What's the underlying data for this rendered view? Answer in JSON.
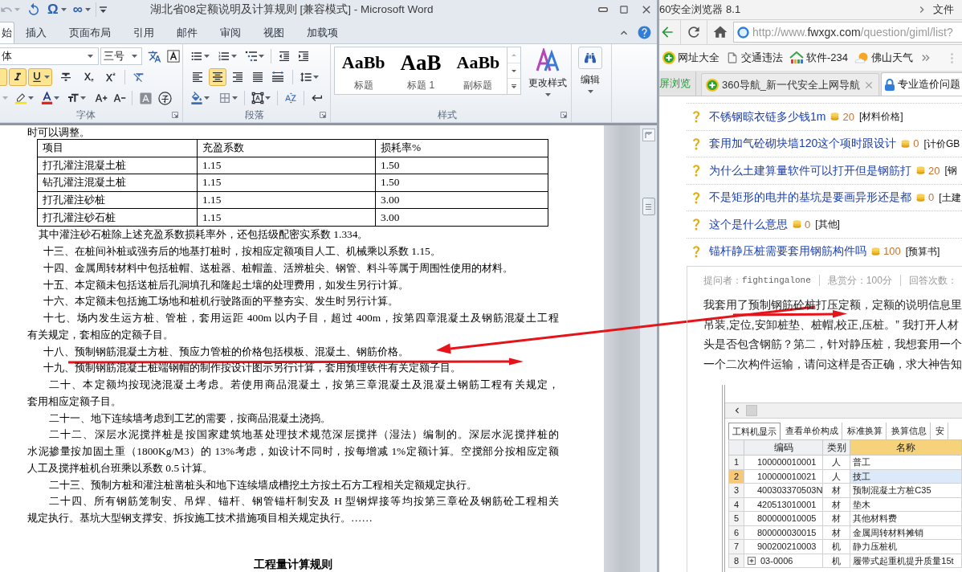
{
  "word": {
    "title": "湖北省08定额说明及计算规则 [兼容模式] - Microsoft Word",
    "quick_access_symbols": [
      "Ω",
      "∞"
    ],
    "tabs": [
      {
        "label": "始",
        "selected": true
      },
      {
        "label": "插入",
        "selected": false
      },
      {
        "label": "页面布局",
        "selected": false
      },
      {
        "label": "引用",
        "selected": false
      },
      {
        "label": "邮件",
        "selected": false
      },
      {
        "label": "审阅",
        "selected": false
      },
      {
        "label": "视图",
        "selected": false
      },
      {
        "label": "加载项",
        "selected": false
      }
    ],
    "ribbon": {
      "font_group": {
        "label": "字体",
        "font_name": "体",
        "font_size": "三号",
        "format_buttons": [
          {
            "kind": "bold",
            "on": true
          },
          {
            "kind": "italic",
            "on": true
          },
          {
            "kind": "underline",
            "on": true
          },
          {
            "kind": "strikethrough",
            "on": false
          },
          {
            "kind": "subscript",
            "on": false
          },
          {
            "kind": "superscript",
            "on": false
          }
        ]
      },
      "paragraph_group": {
        "label": "段落",
        "align_buttons": [
          {
            "kind": "left",
            "selected": false
          },
          {
            "kind": "center",
            "selected": true
          },
          {
            "kind": "right",
            "selected": false
          },
          {
            "kind": "justify",
            "selected": false
          },
          {
            "kind": "distributed",
            "selected": false
          }
        ]
      },
      "styles_group": {
        "label": "样式",
        "styles": [
          {
            "preview": "AaBb",
            "name": "标题"
          },
          {
            "preview": "AaB",
            "name": "标题 1"
          },
          {
            "preview": "AaBb",
            "name": "副标题"
          }
        ],
        "change_styles": "更改样式"
      },
      "editing_group": {
        "label": "编辑"
      }
    },
    "document": {
      "top_line": "时可以调整。",
      "table": {
        "columns": [
          "项目",
          "充盈系数",
          "损耗率%"
        ],
        "rows": [
          [
            "打孔灌注混凝土桩",
            "1.15",
            "1.50"
          ],
          [
            "钻孔灌注混凝土桩",
            "1.15",
            "1.50"
          ],
          [
            "打孔灌注砂桩",
            "1.15",
            "3.00"
          ],
          [
            "打孔灌注砂石桩",
            "1.15",
            "3.00"
          ]
        ]
      },
      "paragraphs": [
        {
          "lines": [
            "其中灌注砂石桩除上述充盈系数损耗率外，还包括级配密实系数 1.334。"
          ]
        },
        {
          "lines": [
            "十三、在桩间补桩或强夯后的地基打桩时，按相应定额项目人工、机械乘以系数 1.15。"
          ]
        },
        {
          "lines": [
            "十四、金属周转材料中包括桩帽、送桩器、桩帽盖、活辨桩尖、钢管、料斗等属于周围性使用的材料。"
          ]
        },
        {
          "lines": [
            "十五、本定额未包括送桩后孔洞填孔和隆起土壤的处理费用，如发生另行计算。"
          ]
        },
        {
          "lines": [
            "十六、本定额未包括施工场地和桩机行驶路面的平整夯实、发生时另行计算。"
          ]
        },
        {
          "lines": [
            "十七、场内发生运方桩、管桩，套用运距 400m 以内子目，超过 400m，按第四章混凝土及钢筋混凝土工程",
            "有关规定，套相应的定额子目。"
          ]
        },
        {
          "lines": [
            "十八、预制钢筋混凝土方桩、预应力管桩的价格包括模板、混凝土、钢筋价格。"
          ]
        },
        {
          "lines": [
            "十九、预制钢筋混凝土桩端钢帽的制作按设计图示另行计算，套用预埋铁件有关定额子目。"
          ]
        },
        {
          "lines": [
            "二十、本定额均按现浇混凝土考虑。若使用商品混凝土，按第三章混凝土及混凝土钢筋工程有关规定，",
            "套用相应定额子目。"
          ]
        },
        {
          "lines": [
            "二十一、地下连续墙考虑到工艺的需要，按商品混凝土浇捣。"
          ]
        },
        {
          "lines": [
            "二十二、深层水泥搅拌桩是按国家建筑地基处理技术规范深层搅拌（湿法）编制的。深层水泥搅拌桩的",
            "水泥掺量按加固土重（1800Kg/M3）的 13%考虑，如设计不同时，按每增减 1%定额计算。空搅部分按相应定额",
            "人工及搅拌桩机台班乘以系数 0.5 计算。"
          ]
        },
        {
          "lines": [
            "二十三、预制方桩和灌注桩凿桩头和地下连续墙成槽挖土方按土石方工程相关定额规定执行。"
          ]
        },
        {
          "lines": [
            "二十四、所有钢筋笼制安、吊焊、锚杆、钢管锚杆制安及 H 型钢焊接等均按第三章砼及钢筋砼工程相关",
            "规定执行。基坑大型钢支撑安、拆按施工技术措施项目相关规定执行。……"
          ]
        }
      ],
      "heading": "工程量计算规则"
    }
  },
  "browser": {
    "title": "60安全浏览器 8.1",
    "menu": "文件",
    "url": {
      "prefix": "http://www.",
      "domain": "fwxgx.com",
      "suffix": "/question/giml/list?"
    },
    "bookmarks": [
      {
        "kind": "nav",
        "label": "网址大全"
      },
      {
        "kind": "page",
        "label": "交通违法"
      },
      {
        "kind": "software",
        "label": "软件-234"
      },
      {
        "kind": "weather",
        "label": "佛山天气"
      }
    ],
    "tabs": [
      {
        "kind": "split",
        "label": "屏浏览",
        "selected": false
      },
      {
        "kind": "nav",
        "label": "360导航_新一代安全上网导航",
        "selected": false
      },
      {
        "kind": "site",
        "label": "专业造价问题",
        "selected": true
      }
    ],
    "questions": [
      {
        "title": "不锈钢晾衣链多少钱1m",
        "points": "20",
        "category": "[材料价格]"
      },
      {
        "title": "套用加气砼砌块墙120这个项时跟设计",
        "points": "0",
        "category": "[计价GB"
      },
      {
        "title": "为什么土建算量软件可以打开但是钢筋打",
        "points": "20",
        "category": "[钢"
      },
      {
        "title": "不是矩形的电井的基坑是要画异形还是都",
        "points": "0",
        "category": "[土建"
      },
      {
        "title": "这个是什么意思",
        "points": "0",
        "category": "[其他]"
      },
      {
        "title": "锚杆静压桩需要套用钢筋构件吗",
        "points": "100",
        "category": "[预算书]"
      }
    ],
    "detail": {
      "asker_label": "提问者：",
      "asker": "fightingalone",
      "reward": "悬赏分：100分",
      "answers_label": "回答次数：",
      "body_lines": [
        "我套用了预制钢筋砼桩打压定额，定额的说明信息里",
        "吊装,定位,安卸桩垫、桩帽,校正,压桩。” 我打开人材",
        "头是否包含钢筋？第二，针对静压桩，我想套用一个",
        "一个二次构件运输，请问这样是否正确，求大神告知"
      ],
      "software": {
        "tabs": [
          {
            "label": "工料机显示",
            "selected": true
          },
          {
            "label": "查看单价构成",
            "selected": false
          },
          {
            "label": "标准换算",
            "selected": false
          },
          {
            "label": "换算信息",
            "selected": false
          },
          {
            "label": "安",
            "selected": false
          }
        ],
        "columns": [
          "编码",
          "类别",
          "名称"
        ],
        "rows": [
          {
            "index": "1",
            "code": "100000010001",
            "type": "人",
            "name": "普工",
            "selected": false,
            "expandable": false
          },
          {
            "index": "2",
            "code": "100000010021",
            "type": "人",
            "name": "技工",
            "selected": true,
            "expandable": false
          },
          {
            "index": "3",
            "code": "400303370503N",
            "type": "材",
            "name": "预制混凝土方桩C35",
            "selected": false,
            "expandable": false
          },
          {
            "index": "4",
            "code": "420513010001",
            "type": "材",
            "name": "垫木",
            "selected": false,
            "expandable": false
          },
          {
            "index": "5",
            "code": "800000010005",
            "type": "材",
            "name": "其他材料费",
            "selected": false,
            "expandable": false
          },
          {
            "index": "6",
            "code": "800000030015",
            "type": "材",
            "name": "金属周转材料摊销",
            "selected": false,
            "expandable": false
          },
          {
            "index": "7",
            "code": "900200210003",
            "type": "机",
            "name": "静力压桩机",
            "selected": false,
            "expandable": false
          },
          {
            "index": "8",
            "code": "03-0006",
            "type": "机",
            "name": "履带式起重机提升质量15t",
            "selected": false,
            "expandable": true
          }
        ]
      }
    }
  }
}
